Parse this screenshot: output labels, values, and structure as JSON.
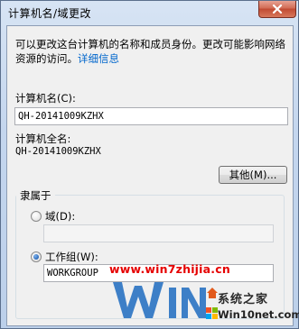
{
  "window": {
    "title": "计算机名/域更改"
  },
  "dialog": {
    "description": "可以更改这台计算机的名称和成员身份。更改可能影响网络资源的访问。",
    "details_link": "详细信息",
    "computer_name_label": "计算机名(C):",
    "computer_name_value": "QH-20141009KZHX",
    "full_name_label": "计算机全名:",
    "full_name_value": "QH-20141009KZHX",
    "more_button": "其他(M)...",
    "member_of_label": "隶属于",
    "domain_label": "域(D):",
    "domain_value": "",
    "workgroup_label": "工作组(W):",
    "workgroup_value": "WORKGROUP",
    "selected_membership": "workgroup"
  },
  "watermarks": {
    "url": "www.win7zhijia.cn",
    "brand_name": "系统之家",
    "brand_site": "Win10net.com"
  },
  "colors": {
    "link": "#0066cc",
    "watermark_red": "#e60000",
    "close_button": "#c14a32"
  },
  "icons": {
    "close": "close-x-icon",
    "radio_domain": "radio-unchecked",
    "radio_workgroup": "radio-checked"
  }
}
